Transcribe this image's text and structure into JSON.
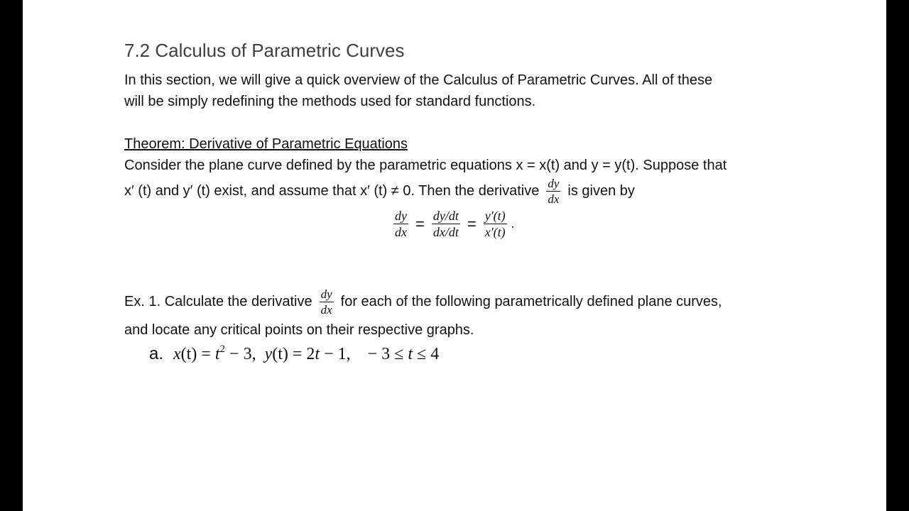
{
  "document": {
    "title": "7.2 Calculus of Parametric Curves",
    "intro": {
      "line1": "In this section, we will give a quick overview of the Calculus of Parametric Curves.  All of these",
      "line2": "will be simply redefining the methods used for standard functions."
    },
    "theorem": {
      "heading": "Theorem: Derivative of Parametric Equations",
      "line1": "Consider the plane curve defined by the parametric equations x = x(t) and y = y(t). Suppose that",
      "line2_before": "x′ (t) and y′ (t) exist, and assume that x′ (t) ≠ 0. Then the derivative",
      "line2_after": "is given by",
      "inline_frac": {
        "num": "dy",
        "den": "dx"
      },
      "formula": {
        "lhs": {
          "num": "dy",
          "den": "dx"
        },
        "eq1": "=",
        "mid": {
          "num": "dy/dt",
          "den": "dx/dt"
        },
        "eq2": "=",
        "rhs": {
          "num": "y′(t)",
          "den": "x′(t)"
        },
        "end": "."
      }
    },
    "example": {
      "line1_before": "Ex. 1.  Calculate the derivative",
      "line1_after": "for each of the following parametrically defined plane curves,",
      "frac": {
        "num": "dy",
        "den": "dx"
      },
      "line2": "and locate any critical points on their respective graphs.",
      "part_a": {
        "label": "a.",
        "x_lhs": "x",
        "x_arg": "(t) = ",
        "x_t": "t",
        "x_exp": "2",
        "x_rest": " − 3,  ",
        "y_lhs": "y",
        "y_arg": "(t) = 2",
        "y_t": "t",
        "y_rest": " − 1,    − 3 ≤ ",
        "range_t": "t",
        "range_end": " ≤ 4"
      }
    }
  }
}
